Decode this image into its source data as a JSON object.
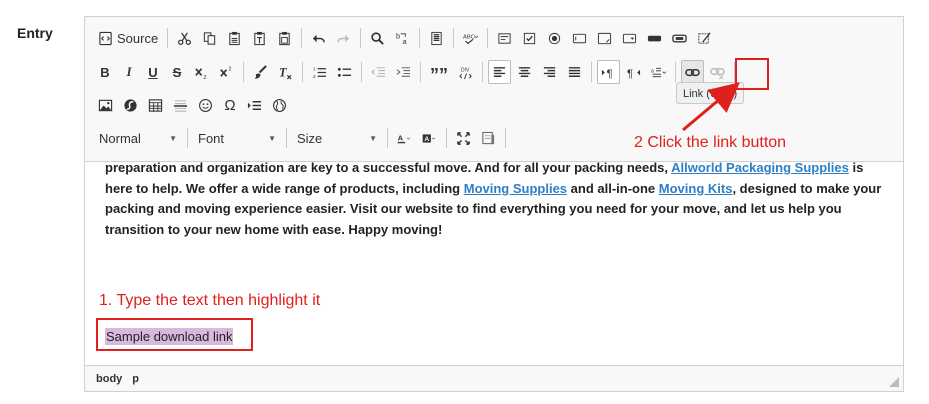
{
  "field": {
    "label": "Entry"
  },
  "toolbar": {
    "source_label": "Source",
    "format_label": "Normal",
    "font_label": "Font",
    "size_label": "Size",
    "tooltip": "Link (⌘+L)"
  },
  "content": {
    "text1": "preparation and organization are key to a successful move. And for all your packing needs, ",
    "link1": "Allworld Packaging Supplies",
    "text2": " is here to help. We offer a wide range of products, including ",
    "link2": "Moving Supplies",
    "text3": " and all-in-one ",
    "link3": "Moving Kits",
    "text4": ", designed to make your packing and moving experience easier. Visit our website to find everything you need for your move, and let us help you transition to your new home with ease. Happy moving!",
    "selected_text": "Sample download link"
  },
  "status": {
    "path1": "body",
    "path2": "p"
  },
  "annotations": {
    "step1": "1. Type the text then highlight it",
    "step2": "2 Click the link button",
    "color": "#e0201a"
  }
}
